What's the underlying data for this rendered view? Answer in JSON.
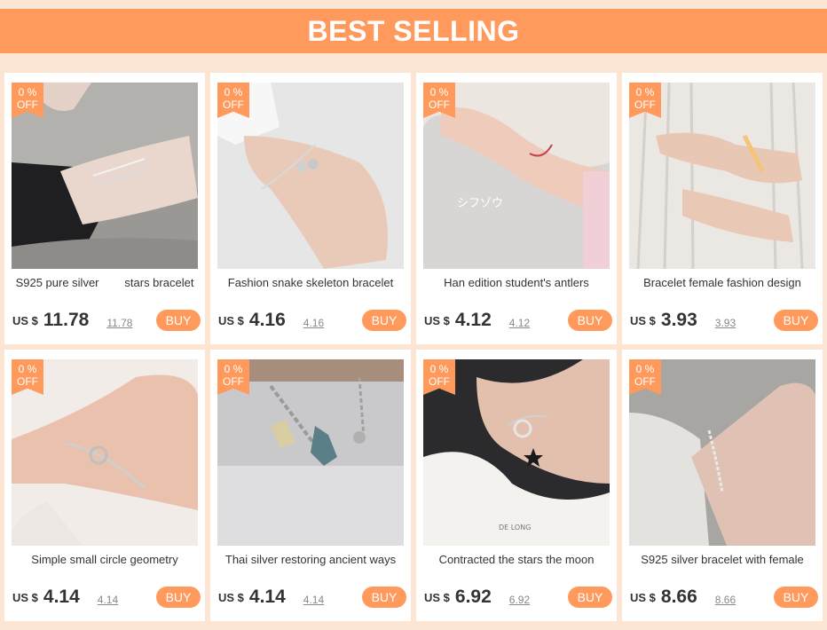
{
  "banner": {
    "title": "BEST SELLING"
  },
  "colors": {
    "accent": "#ff9a5c",
    "background": "#fde5d3"
  },
  "products": [
    {
      "discount_value": "0 %",
      "discount_label": "OFF",
      "title": "S925 pure silver        stars bracelet",
      "currency": "US $",
      "price": "11.78",
      "old_price": "11.78",
      "buy_label": "BUY"
    },
    {
      "discount_value": "0 %",
      "discount_label": "OFF",
      "title": "Fashion snake skeleton bracelet",
      "currency": "US $",
      "price": "4.16",
      "old_price": "4.16",
      "buy_label": "BUY"
    },
    {
      "discount_value": "0 %",
      "discount_label": "OFF",
      "title": "Han edition student's antlers",
      "currency": "US $",
      "price": "4.12",
      "old_price": "4.12",
      "buy_label": "BUY",
      "image_text": [
        "シフゾウ"
      ]
    },
    {
      "discount_value": "0 %",
      "discount_label": "OFF",
      "title": "Bracelet female fashion design",
      "currency": "US $",
      "price": "3.93",
      "old_price": "3.93",
      "buy_label": "BUY"
    },
    {
      "discount_value": "0 %",
      "discount_label": "OFF",
      "title": "Simple small circle geometry",
      "currency": "US $",
      "price": "4.14",
      "old_price": "4.14",
      "buy_label": "BUY"
    },
    {
      "discount_value": "0 %",
      "discount_label": "OFF",
      "title": "Thai silver restoring ancient ways",
      "currency": "US $",
      "price": "4.14",
      "old_price": "4.14",
      "buy_label": "BUY"
    },
    {
      "discount_value": "0 %",
      "discount_label": "OFF",
      "title": "Contracted the stars the moon",
      "currency": "US $",
      "price": "6.92",
      "old_price": "6.92",
      "buy_label": "BUY",
      "image_text": [
        "DE LONG"
      ]
    },
    {
      "discount_value": "0 %",
      "discount_label": "OFF",
      "title": "S925 silver bracelet with female",
      "currency": "US $",
      "price": "8.66",
      "old_price": "8.66",
      "buy_label": "BUY"
    }
  ]
}
